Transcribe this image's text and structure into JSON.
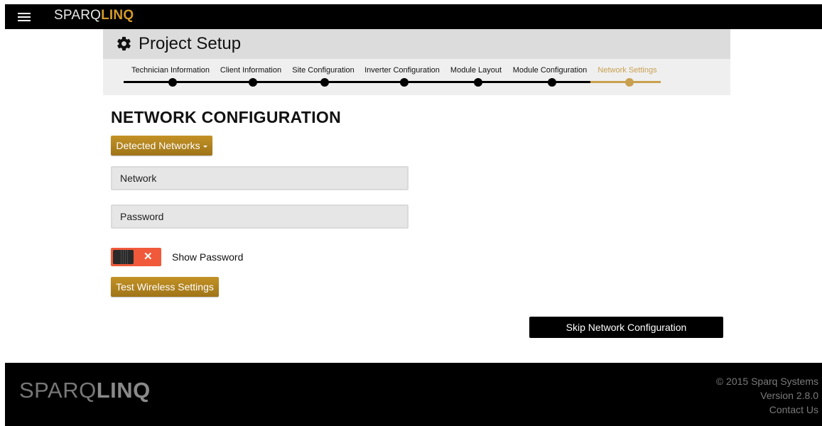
{
  "topbar": {
    "menu_icon": "hamburger-icon",
    "brand_part1": "SPARQ",
    "brand_part2": "LINQ"
  },
  "header": {
    "icon": "gear-icon",
    "title": "Project Setup"
  },
  "stepper": {
    "steps": [
      {
        "label": "Technician Information"
      },
      {
        "label": "Client Information"
      },
      {
        "label": "Site Configuration"
      },
      {
        "label": "Inverter Configuration"
      },
      {
        "label": "Module Layout"
      },
      {
        "label": "Module Configuration"
      },
      {
        "label": "Network Settings"
      }
    ],
    "active_step": "Network Settings"
  },
  "main": {
    "section_title": "NETWORK CONFIGURATION",
    "detected_networks_label": "Detected Networks",
    "network_field": {
      "value": "",
      "placeholder": "Network"
    },
    "password_field": {
      "value": "",
      "placeholder": "Password"
    },
    "show_password_toggle": {
      "state": "off",
      "symbol": "✕"
    },
    "show_password_label": "Show Password",
    "test_button_label": "Test Wireless Settings",
    "skip_button_label": "Skip Network Configuration"
  },
  "footer": {
    "brand_part1": "SPARQ",
    "brand_part2": "LINQ",
    "copyright": "© 2015 Sparq Systems",
    "version": "Version 2.8.0",
    "contact_link": "Contact Us"
  },
  "colors": {
    "accent_gold": "#c39226",
    "active_step": "#c9a050",
    "toggle_off": "#f05a3a",
    "topbar": "#000000"
  }
}
